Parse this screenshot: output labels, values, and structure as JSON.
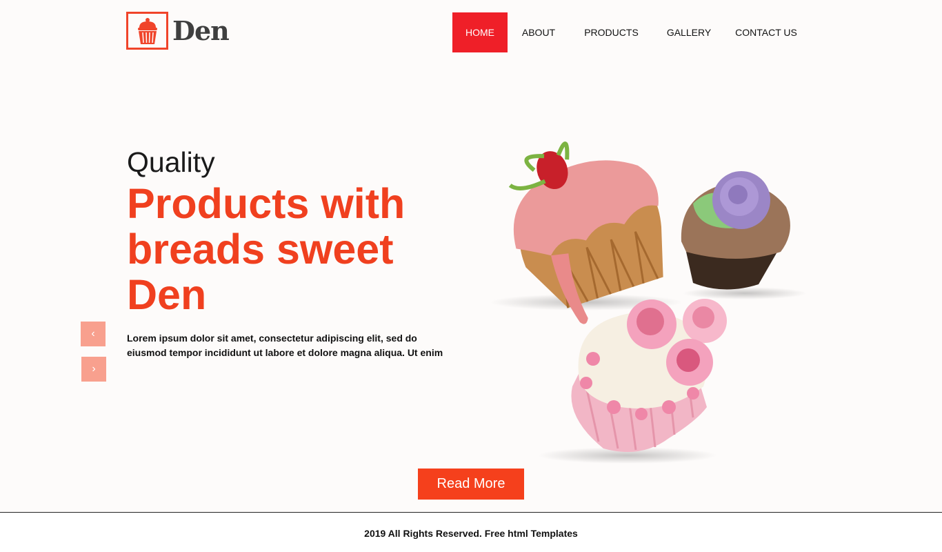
{
  "brand": {
    "name": "Den",
    "accent": "#f0442a"
  },
  "nav": {
    "items": [
      {
        "label": "HOME",
        "active": true
      },
      {
        "label": "ABOUT"
      },
      {
        "label": "PRODUCTS"
      },
      {
        "label": "GALLERY"
      },
      {
        "label": "CONTACT US"
      }
    ]
  },
  "hero": {
    "kicker": "Quality",
    "title": "Products with breads sweet Den",
    "description": "Lorem ipsum dolor sit amet, consectetur adipiscing elit, sed do eiusmod tempor incididunt ut labore et dolore magna aliqua. Ut enim",
    "button_label": "Read More",
    "prev_icon": "‹",
    "next_icon": "›"
  },
  "colors": {
    "active_nav": "#ef1f28",
    "title": "#f0401f",
    "button": "#f5401c",
    "arrow": "#f8a08e"
  },
  "footer": {
    "text": "2019 All Rights Reserved. Free html Templates"
  }
}
